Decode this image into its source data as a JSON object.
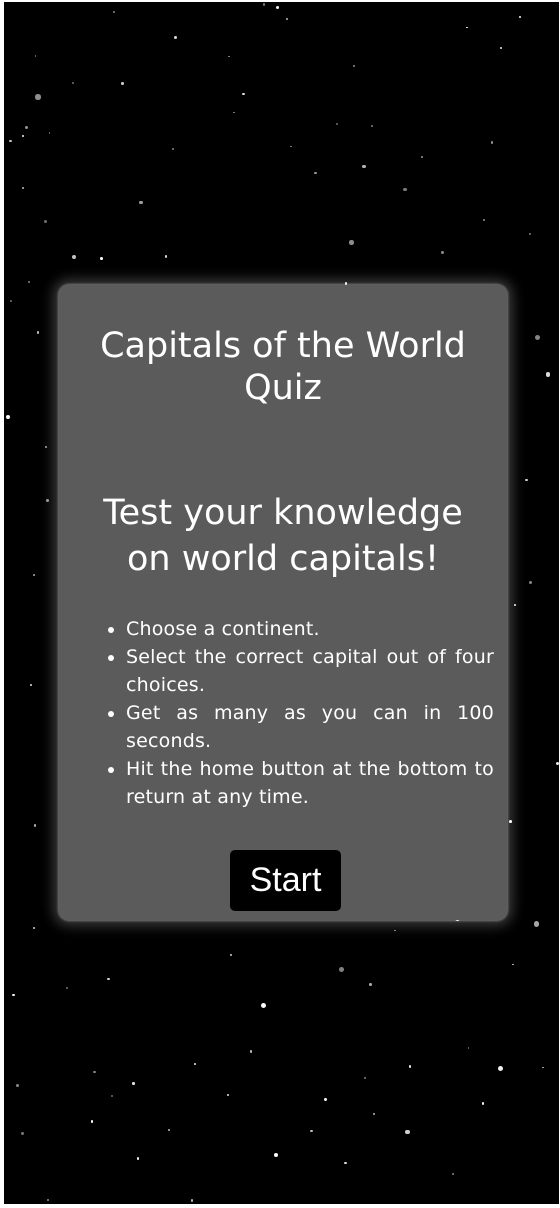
{
  "card": {
    "title": "Capitals of the World Quiz",
    "subtitle": "Test your knowledge on world capitals!",
    "rules": [
      "Choose a continent.",
      "Select the correct capital out of four choices.",
      "Get as many as you can in 100 seconds.",
      "Hit the home button at the bottom to return at any time."
    ],
    "start_label": "Start"
  },
  "colors": {
    "background": "#000000",
    "card": "#5b5b5b",
    "text": "#ffffff",
    "button": "#000000"
  }
}
